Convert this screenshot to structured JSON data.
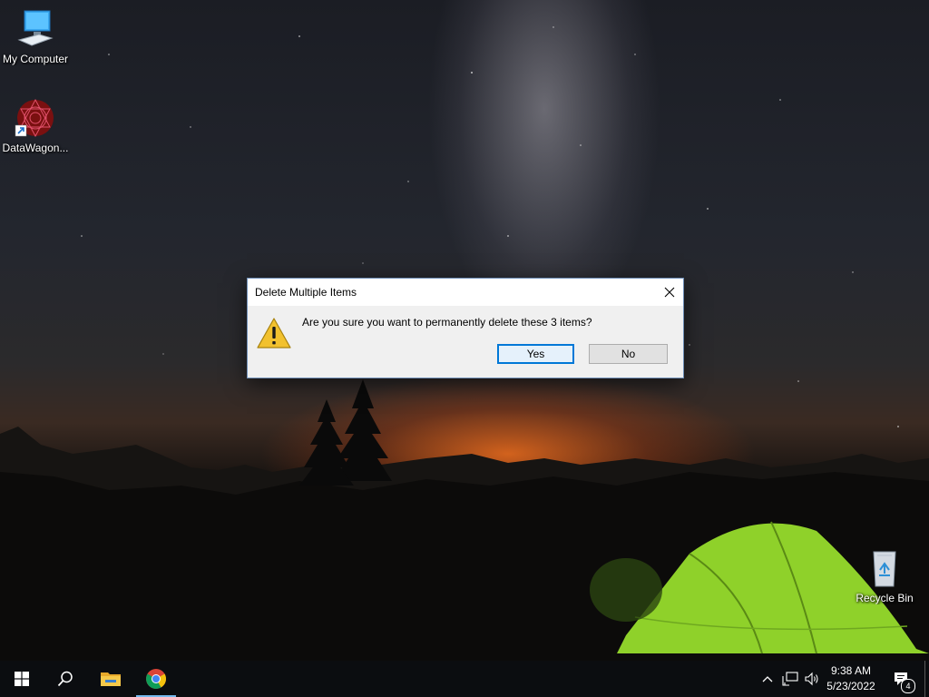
{
  "desktop": {
    "icons": [
      {
        "label": "My Computer",
        "icon": "monitor-icon"
      },
      {
        "label": "DataWagon...",
        "icon": "datawagon-shortcut-icon"
      },
      {
        "label": "Recycle Bin",
        "icon": "recycle-bin-icon"
      }
    ]
  },
  "dialog": {
    "title": "Delete Multiple Items",
    "message": "Are you sure you want to permanently delete these 3 items?",
    "icon": "warning-icon",
    "yes_label": "Yes",
    "no_label": "No",
    "close_icon": "close-icon"
  },
  "taskbar": {
    "buttons": [
      {
        "name": "start",
        "icon": "windows-logo-icon"
      },
      {
        "name": "search",
        "icon": "search-icon"
      },
      {
        "name": "file-explorer",
        "icon": "folder-icon"
      },
      {
        "name": "chrome",
        "icon": "chrome-icon",
        "active": true
      }
    ],
    "tray": {
      "icons": [
        "chevron-up-icon",
        "network-icon",
        "volume-icon",
        "notification-icon"
      ],
      "time": "9:38 AM",
      "date": "5/23/2022",
      "notification_count": "4"
    }
  },
  "colors": {
    "accent": "#0078d7",
    "taskbar": "#0b0d10",
    "dialog_bg": "#f0f0f0",
    "tent_green": "#8fd12a"
  }
}
